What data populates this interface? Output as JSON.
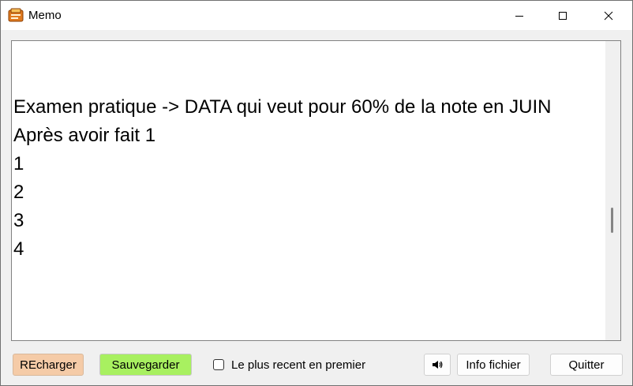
{
  "window": {
    "title": "Memo",
    "icon": "memo-app-icon",
    "controls": [
      "minimize-icon",
      "maximize-icon",
      "close-icon"
    ]
  },
  "editor": {
    "text": "Examen pratique -> DATA qui veut pour 60% de la note en JUIN\nAprès avoir fait 1\n1\n2\n3\n4"
  },
  "toolbar": {
    "reload_label": "REcharger",
    "save_label": "Sauvegarder",
    "newest_first_label": "Le plus recent en premier",
    "newest_first_checked": false,
    "sound_icon": "speaker-icon",
    "file_info_label": "Info fichier",
    "quit_label": "Quitter"
  },
  "colors": {
    "reload_button": "#f5cba7",
    "save_button": "#a8f060"
  }
}
